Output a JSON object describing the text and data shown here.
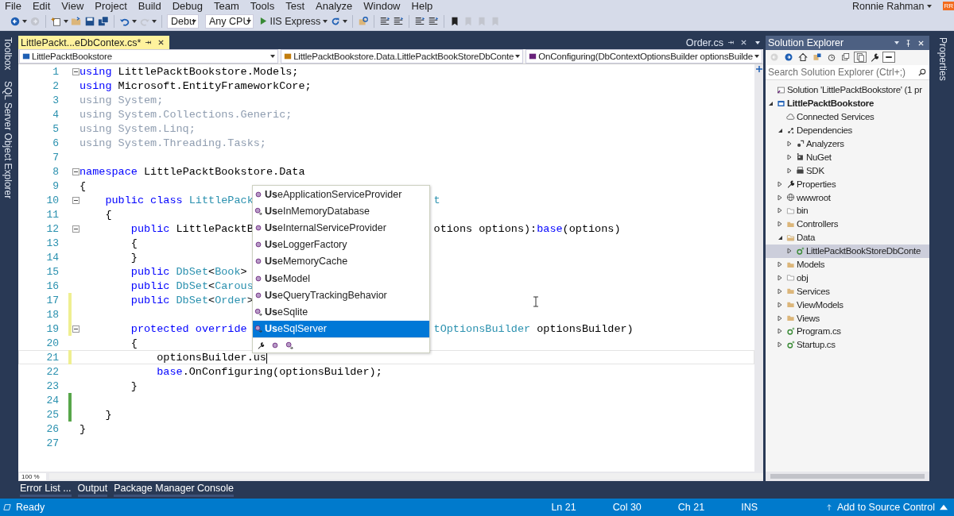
{
  "menu": [
    "File",
    "Edit",
    "View",
    "Project",
    "Build",
    "Debug",
    "Team",
    "Tools",
    "Test",
    "Analyze",
    "Window",
    "Help"
  ],
  "account": {
    "name": "Ronnie Rahman",
    "initials": "RR"
  },
  "toolbar": [
    {
      "kind": "back",
      "disabled": false,
      "dropdown": true
    },
    {
      "kind": "forward",
      "disabled": true,
      "dropdown": false
    },
    {
      "kind": "separator"
    },
    {
      "kind": "new",
      "disabled": false,
      "dropdown": true
    },
    {
      "kind": "open",
      "disabled": false,
      "dropdown": false
    },
    {
      "kind": "save",
      "disabled": false,
      "dropdown": false
    },
    {
      "kind": "saveall",
      "disabled": false,
      "dropdown": false
    },
    {
      "kind": "separator"
    },
    {
      "kind": "undo",
      "disabled": false,
      "dropdown": true
    },
    {
      "kind": "redo",
      "disabled": true,
      "dropdown": true
    },
    {
      "kind": "separator"
    },
    {
      "kind": "combo",
      "value": "Debu"
    },
    {
      "kind": "combo",
      "value": "Any CPU"
    },
    {
      "kind": "run",
      "label": "IIS Express"
    },
    {
      "kind": "refresh",
      "disabled": false,
      "dropdown": true
    },
    {
      "kind": "separator"
    },
    {
      "kind": "find",
      "disabled": false,
      "dropdown": false
    },
    {
      "kind": "separator"
    },
    {
      "kind": "lines",
      "disabled": false,
      "dropdown": false
    },
    {
      "kind": "lines",
      "disabled": false,
      "dropdown": false
    },
    {
      "kind": "separator"
    },
    {
      "kind": "lines",
      "disabled": false,
      "dropdown": false
    },
    {
      "kind": "lines",
      "disabled": false,
      "dropdown": false
    },
    {
      "kind": "separator"
    },
    {
      "kind": "bookmark",
      "disabled": false,
      "dropdown": false
    },
    {
      "kind": "bookmark",
      "disabled": true,
      "dropdown": false
    },
    {
      "kind": "bookmark",
      "disabled": true,
      "dropdown": false
    },
    {
      "kind": "bookmark",
      "disabled": true,
      "dropdown": false
    }
  ],
  "left_strip": [
    "Toolbox",
    "SQL Server Object Explorer"
  ],
  "editor": {
    "tabs": [
      {
        "label": "LittlePackt...eDbContex.cs*",
        "selected": true
      },
      {
        "label": "Order.cs",
        "selected": false
      }
    ],
    "nav": [
      "LittlePacktBookstore",
      "LittlePacktBookstore.Data.LittlePacktBookStoreDbConte",
      "OnConfiguring(DbContextOptionsBuilder optionsBuilde"
    ],
    "lines": [
      {
        "n": "1",
        "fold": true,
        "modified": false,
        "current": false,
        "tokens": [
          {
            "kind": "kw",
            "text": "using"
          },
          {
            "kind": "plain",
            "text": " LittlePacktBookstore.Models;"
          }
        ]
      },
      {
        "n": "2",
        "fold": false,
        "modified": false,
        "current": false,
        "tokens": [
          {
            "kind": "kw",
            "text": "using"
          },
          {
            "kind": "plain",
            "text": " Microsoft.EntityFrameworkCore;"
          }
        ]
      },
      {
        "n": "3",
        "fold": false,
        "modified": false,
        "current": false,
        "tokens": [
          {
            "kind": "dim",
            "text": "using System;"
          }
        ]
      },
      {
        "n": "4",
        "fold": false,
        "modified": false,
        "current": false,
        "tokens": [
          {
            "kind": "dim",
            "text": "using System.Collections.Generic;"
          }
        ]
      },
      {
        "n": "5",
        "fold": false,
        "modified": false,
        "current": false,
        "tokens": [
          {
            "kind": "dim",
            "text": "using System.Linq;"
          }
        ]
      },
      {
        "n": "6",
        "fold": false,
        "modified": false,
        "current": false,
        "tokens": [
          {
            "kind": "dim",
            "text": "using System.Threading.Tasks;"
          }
        ]
      },
      {
        "n": "7",
        "fold": false,
        "modified": false,
        "current": false
      },
      {
        "n": "8",
        "fold": true,
        "modified": false,
        "current": false,
        "tokens": [
          {
            "kind": "kw",
            "text": "namespace"
          },
          {
            "kind": "plain",
            "text": " LittlePacktBookstore.Data"
          }
        ]
      },
      {
        "n": "9",
        "fold": false,
        "modified": false,
        "current": false,
        "tokens": [
          {
            "kind": "plain",
            "text": "{"
          }
        ]
      },
      {
        "n": "10",
        "fold": true,
        "modified": false,
        "current": false,
        "tokens": [
          {
            "kind": "kw",
            "text": "    public"
          },
          {
            "kind": "kw",
            "text": " class"
          },
          {
            "kind": "type",
            "text": " LittlePack"
          }
        ],
        "tail": [
          {
            "kind": "type",
            "text": "t"
          }
        ]
      },
      {
        "n": "11",
        "fold": false,
        "modified": false,
        "current": false,
        "tokens": [
          {
            "kind": "plain",
            "text": "    {"
          }
        ]
      },
      {
        "n": "12",
        "fold": true,
        "modified": false,
        "current": false,
        "tokens": [
          {
            "kind": "kw",
            "text": "        public"
          },
          {
            "kind": "plain",
            "text": " LittlePacktB"
          }
        ],
        "tail": [
          {
            "kind": "plain",
            "text": "otions options):"
          },
          {
            "kind": "kw",
            "text": "base"
          },
          {
            "kind": "plain",
            "text": "(options)"
          }
        ]
      },
      {
        "n": "13",
        "fold": false,
        "modified": false,
        "current": false,
        "tokens": [
          {
            "kind": "plain",
            "text": "        {"
          }
        ]
      },
      {
        "n": "14",
        "fold": false,
        "modified": false,
        "current": false,
        "tokens": [
          {
            "kind": "plain",
            "text": "        }"
          }
        ]
      },
      {
        "n": "15",
        "fold": false,
        "modified": false,
        "current": false,
        "tokens": [
          {
            "kind": "kw",
            "text": "        public"
          },
          {
            "kind": "type",
            "text": " DbSet"
          },
          {
            "kind": "plain",
            "text": "<"
          },
          {
            "kind": "type",
            "text": "Book"
          },
          {
            "kind": "plain",
            "text": ">"
          }
        ]
      },
      {
        "n": "16",
        "fold": false,
        "modified": false,
        "current": false,
        "tokens": [
          {
            "kind": "kw",
            "text": "        public"
          },
          {
            "kind": "type",
            "text": " DbSet"
          },
          {
            "kind": "plain",
            "text": "<"
          },
          {
            "kind": "type",
            "text": "Carous"
          }
        ]
      },
      {
        "n": "17",
        "fold": false,
        "modified": true,
        "saved": false,
        "current": false,
        "tokens": [
          {
            "kind": "kw",
            "text": "        public"
          },
          {
            "kind": "type",
            "text": " DbSet"
          },
          {
            "kind": "plain",
            "text": "<"
          },
          {
            "kind": "type",
            "text": "Order"
          },
          {
            "kind": "plain",
            "text": ">"
          }
        ]
      },
      {
        "n": "18",
        "fold": false,
        "modified": true,
        "saved": false,
        "current": false
      },
      {
        "n": "19",
        "fold": true,
        "modified": true,
        "saved": false,
        "current": false,
        "tokens": [
          {
            "kind": "kw",
            "text": "        protected"
          },
          {
            "kind": "kw",
            "text": " override"
          }
        ],
        "tail": [
          {
            "kind": "type",
            "text": "tOptionsBuilder"
          },
          {
            "kind": "plain",
            "text": " optionsBuilder)"
          }
        ]
      },
      {
        "n": "20",
        "fold": false,
        "modified": false,
        "current": false,
        "tokens": [
          {
            "kind": "plain",
            "text": "        {"
          }
        ]
      },
      {
        "n": "21",
        "fold": false,
        "modified": true,
        "saved": false,
        "current": true,
        "tokens": [
          {
            "kind": "plain",
            "text": "            optionsBuilder.us"
          }
        ]
      },
      {
        "n": "22",
        "fold": false,
        "modified": false,
        "current": false,
        "tokens": [
          {
            "kind": "kw",
            "text": "            base"
          },
          {
            "kind": "plain",
            "text": ".OnConfiguring(optionsBuilder);"
          }
        ]
      },
      {
        "n": "23",
        "fold": false,
        "modified": false,
        "current": false,
        "tokens": [
          {
            "kind": "plain",
            "text": "        }"
          }
        ]
      },
      {
        "n": "24",
        "fold": false,
        "modified": true,
        "saved": true,
        "current": false
      },
      {
        "n": "25",
        "fold": false,
        "modified": true,
        "saved": true,
        "current": false,
        "tokens": [
          {
            "kind": "plain",
            "text": "    }"
          }
        ]
      },
      {
        "n": "26",
        "fold": false,
        "modified": false,
        "current": false,
        "tokens": [
          {
            "kind": "plain",
            "text": "}"
          }
        ]
      },
      {
        "n": "27",
        "fold": false,
        "modified": false,
        "current": false
      }
    ],
    "completion": [
      {
        "label": "**Us**eApplicationServiceProvider",
        "kind": "method",
        "selected": false
      },
      {
        "label": "**Us**eInMemoryDatabase",
        "kind": "extension",
        "selected": false
      },
      {
        "label": "**Us**eInternalServiceProvider",
        "kind": "method",
        "selected": false
      },
      {
        "label": "**Us**eLoggerFactory",
        "kind": "method",
        "selected": false
      },
      {
        "label": "**Us**eMemoryCache",
        "kind": "method",
        "selected": false
      },
      {
        "label": "**Us**eModel",
        "kind": "method",
        "selected": false
      },
      {
        "label": "**Us**eQueryTrackingBehavior",
        "kind": "method",
        "selected": false
      },
      {
        "label": "**Us**eSqlite",
        "kind": "extension",
        "selected": false
      },
      {
        "label": "**Us**eSqlServer",
        "kind": "extension",
        "selected": true
      }
    ],
    "zoom": "100 %"
  },
  "solution_explorer": {
    "title": "Solution Explorer",
    "toolbar": [
      {
        "kind": "back",
        "disabled": true,
        "pressed": false
      },
      {
        "kind": "forward",
        "disabled": false,
        "pressed": false
      },
      {
        "kind": "home",
        "disabled": false,
        "pressed": false
      },
      {
        "kind": "views",
        "disabled": false,
        "pressed": false
      },
      {
        "kind": "history",
        "disabled": false,
        "pressed": false
      },
      {
        "kind": "collapse",
        "disabled": false,
        "pressed": false
      },
      {
        "kind": "showall",
        "disabled": false,
        "pressed": true
      },
      {
        "kind": "wrench",
        "disabled": false,
        "pressed": false
      },
      {
        "kind": "preview",
        "disabled": false,
        "pressed": true
      }
    ],
    "search": {
      "placeholder": "Search Solution Explorer (Ctrl+;)"
    },
    "tree": [
      {
        "label": "Solution 'LittlePacktBookstore' (1 pr",
        "kind": "solution",
        "selected": false,
        "children": [
          {
            "label": "LittlePacktBookstore",
            "kind": "project",
            "expanded": true,
            "selected": false,
            "children": [
              {
                "label": "Connected Services",
                "kind": "service",
                "selected": false
              },
              {
                "label": "Dependencies",
                "kind": "dependencies",
                "expanded": true,
                "selected": false,
                "children": [
                  {
                    "label": "Analyzers",
                    "kind": "analyzers",
                    "expanded": false,
                    "selected": false
                  },
                  {
                    "label": "NuGet",
                    "kind": "nuget",
                    "expanded": false,
                    "selected": false
                  },
                  {
                    "label": "SDK",
                    "kind": "sdk",
                    "expanded": false,
                    "selected": false
                  }
                ]
              },
              {
                "label": "Properties",
                "kind": "properties",
                "expanded": false,
                "selected": false
              },
              {
                "label": "wwwroot",
                "kind": "web",
                "expanded": false,
                "selected": false
              },
              {
                "label": "bin",
                "kind": "folder-empty",
                "expanded": false,
                "selected": false
              },
              {
                "label": "Controllers",
                "kind": "folder",
                "expanded": false,
                "selected": false
              },
              {
                "label": "Data",
                "kind": "folder-open",
                "expanded": true,
                "selected": false,
                "children": [
                  {
                    "label": "LittlePacktBookStoreDbConte",
                    "kind": "csfile",
                    "expanded": false,
                    "selected": true
                  }
                ]
              },
              {
                "label": "Models",
                "kind": "folder",
                "expanded": false,
                "selected": false
              },
              {
                "label": "obj",
                "kind": "folder-empty",
                "expanded": false,
                "selected": false
              },
              {
                "label": "Services",
                "kind": "folder",
                "expanded": false,
                "selected": false
              },
              {
                "label": "ViewModels",
                "kind": "folder",
                "expanded": false,
                "selected": false
              },
              {
                "label": "Views",
                "kind": "folder",
                "expanded": false,
                "selected": false
              },
              {
                "label": "Program.cs",
                "kind": "csfile",
                "expanded": false,
                "selected": false
              },
              {
                "label": "Startup.cs",
                "kind": "csfile",
                "expanded": false,
                "selected": false
              }
            ]
          }
        ]
      }
    ]
  },
  "right_strip": [
    "Properties"
  ],
  "bottom_tabs": [
    "Error List ...",
    "Output",
    "Package Manager Console"
  ],
  "status_bar": {
    "state": "Ready",
    "cells": [
      "Ln 21",
      "Col 30",
      "Ch 21",
      "INS"
    ],
    "source_control": "Add to Source Control"
  }
}
